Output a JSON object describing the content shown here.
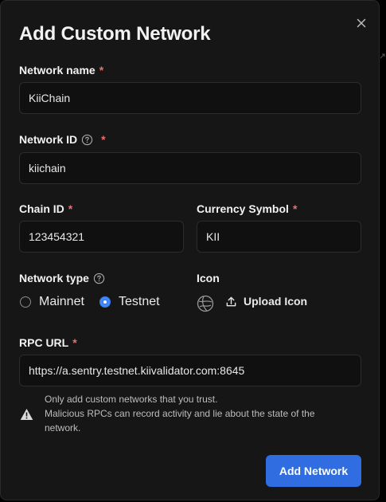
{
  "modal": {
    "title": "Add Custom Network",
    "close_icon": "close-icon"
  },
  "form": {
    "network_name": {
      "label": "Network name",
      "required_mark": "*",
      "value": "KiiChain"
    },
    "network_id": {
      "label": "Network ID",
      "required_mark": "*",
      "help_icon": "help-circle-icon",
      "value": "kiichain"
    },
    "chain_id": {
      "label": "Chain ID",
      "required_mark": "*",
      "value": "123454321"
    },
    "currency_symbol": {
      "label": "Currency Symbol",
      "required_mark": "*",
      "value": "KII"
    },
    "network_type": {
      "label": "Network type",
      "help_icon": "help-circle-icon",
      "options": [
        {
          "label": "Mainnet",
          "selected": false
        },
        {
          "label": "Testnet",
          "selected": true
        }
      ]
    },
    "icon": {
      "label": "Icon",
      "placeholder_icon": "globe-icon",
      "upload_label": "Upload Icon",
      "upload_icon": "upload-icon"
    },
    "rpc_url": {
      "label": "RPC URL",
      "required_mark": "*",
      "value": "https://a.sentry.testnet.kiivalidator.com:8645"
    }
  },
  "warning": {
    "icon": "warning-triangle-icon",
    "line1": "Only add custom networks that you trust.",
    "line2": "Malicious RPCs can record activity and lie about the state of the",
    "line3": "network."
  },
  "actions": {
    "submit_label": "Add Network"
  },
  "colors": {
    "background": "#161616",
    "field_background": "#101010",
    "accent": "#2f6de1",
    "required": "#f26b6b",
    "radio_selected": "#3b82f6"
  }
}
